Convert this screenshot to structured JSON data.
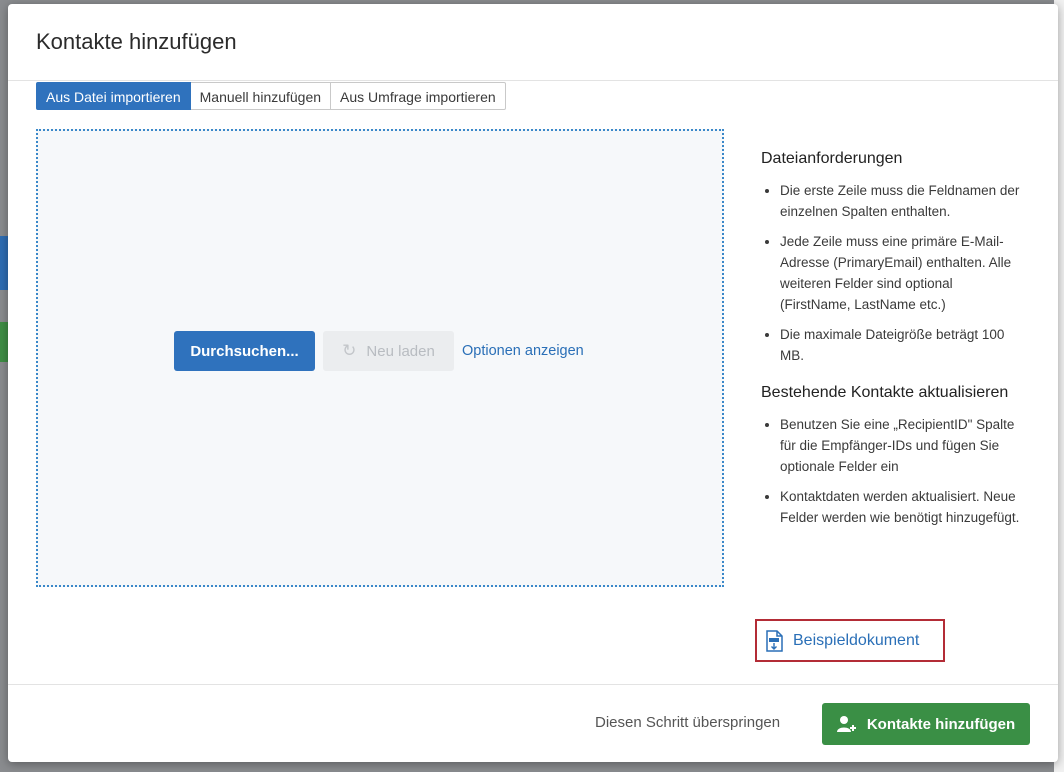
{
  "modal": {
    "title": "Kontakte hinzufügen",
    "tabs": [
      {
        "label": "Aus Datei importieren",
        "active": true
      },
      {
        "label": "Manuell hinzufügen",
        "active": false
      },
      {
        "label": "Aus Umfrage importieren",
        "active": false
      }
    ]
  },
  "dropzone": {
    "browse_label": "Durchsuchen...",
    "reload_label": "Neu laden",
    "reload_icon": "reload-icon",
    "options_label": "Optionen anzeigen"
  },
  "sidebar": {
    "requirements_title": "Dateianforderungen",
    "requirements": [
      "Die erste Zeile muss die Feldnamen der einzelnen Spalten enthalten.",
      "Jede Zeile muss eine primäre E-Mail-Adresse (PrimaryEmail) enthalten. Alle weiteren Felder sind optional (FirstName, LastName etc.)",
      "Die maximale Dateigröße beträgt 100 MB."
    ],
    "update_title": "Bestehende Kontakte aktualisieren",
    "update_items": [
      "Benutzen Sie eine „RecipientID\" Spalte für die Empfänger-IDs und fügen Sie optionale Felder ein",
      "Kontaktdaten werden aktualisiert. Neue Felder werden wie benötigt hinzugefügt."
    ],
    "sample_label": "Beispieldokument",
    "sample_icon": "csv-document-icon"
  },
  "footer": {
    "skip_label": "Diesen Schritt überspringen",
    "add_label": "Kontakte hinzufügen",
    "add_icon": "add-user-icon"
  },
  "colors": {
    "primary": "#2f72bd",
    "success": "#3a8f45",
    "highlight": "#b32c36",
    "link": "#2a6fb7"
  }
}
